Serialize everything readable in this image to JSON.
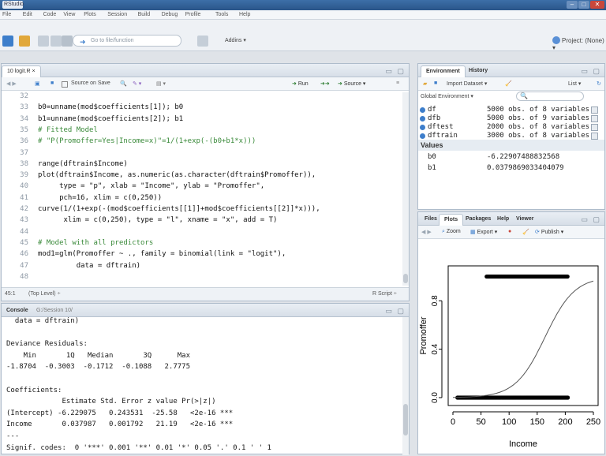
{
  "window": {
    "title": "RStudio",
    "min": "–",
    "max": "□",
    "close": "✕"
  },
  "menu": [
    "File",
    "Edit",
    "Code",
    "View",
    "Plots",
    "Session",
    "Build",
    "Debug",
    "Profile",
    "Tools",
    "Help"
  ],
  "toolbar": {
    "goto_placeholder": "Go to file/function",
    "addins": "Addins ▾",
    "project": "Project: (None) ▾"
  },
  "editor": {
    "tab": "10 logit.R ×",
    "source_on_save": "Source on Save",
    "run": "Run",
    "source": "Source ▾",
    "status_pos": "45:1",
    "status_level": "(Top Level) ÷",
    "status_lang": "R Script ÷",
    "lines": [
      {
        "n": "32",
        "t": ""
      },
      {
        "n": "33",
        "t": "b0=unname(mod$coefficients[1]); b0"
      },
      {
        "n": "34",
        "t": "b1=unname(mod$coefficients[2]); b1"
      },
      {
        "n": "35",
        "t": "# Fitted Model",
        "comment": true
      },
      {
        "n": "36",
        "t": "# \"P(Promoffer=Yes|Income=x)\"=1/(1+exp(-(b0+b1*x)))",
        "comment": true
      },
      {
        "n": "37",
        "t": ""
      },
      {
        "n": "38",
        "t": "range(dftrain$Income)"
      },
      {
        "n": "39",
        "t": "plot(dftrain$Income, as.numeric(as.character(dftrain$Promoffer)),"
      },
      {
        "n": "40",
        "t": "     type = \"p\", xlab = \"Income\", ylab = \"Promoffer\","
      },
      {
        "n": "41",
        "t": "     pch=16, xlim = c(0,250))"
      },
      {
        "n": "42",
        "t": "curve(1/(1+exp(-(mod$coefficients[[1]]+mod$coefficients[[2]]*x))),"
      },
      {
        "n": "43",
        "t": "      xlim = c(0,250), type = \"l\", xname = \"x\", add = T)"
      },
      {
        "n": "44",
        "t": ""
      },
      {
        "n": "45",
        "t": "# Model with all predictors",
        "comment": true
      },
      {
        "n": "46",
        "t": "mod1=glm(Promoffer ~ ., family = binomial(link = \"logit\"),"
      },
      {
        "n": "47",
        "t": "         data = dftrain)"
      },
      {
        "n": "48",
        "t": ""
      }
    ]
  },
  "console": {
    "tab": "Console",
    "path": "G:/Session 10/",
    "lines": [
      "  data = dftrain)",
      "",
      "Deviance Residuals:",
      "    Min       1Q   Median       3Q      Max",
      "-1.8704  -0.3003  -0.1712  -0.1088   2.7775",
      "",
      "Coefficients:",
      "             Estimate Std. Error z value Pr(>|z|)",
      "(Intercept) -6.229075   0.243531  -25.58   <2e-16 ***",
      "Income       0.037987   0.001792   21.19   <2e-16 ***",
      "---",
      "Signif. codes:  0 '***' 0.001 '**' 0.01 '*' 0.05 '.' 0.1 ' ' 1"
    ]
  },
  "environment": {
    "tabs": [
      "Environment",
      "History"
    ],
    "import": "Import Dataset ▾",
    "list": "List ▾",
    "scope": "Global Environment ▾",
    "data_rows": [
      {
        "name": "df",
        "value": "5000 obs. of 8 variables"
      },
      {
        "name": "dfb",
        "value": "5000 obs. of 9 variables"
      },
      {
        "name": "dftest",
        "value": "2000 obs. of 8 variables"
      },
      {
        "name": "dftrain",
        "value": "3000 obs. of 8 variables"
      }
    ],
    "values_header": "Values",
    "value_rows": [
      {
        "name": "b0",
        "value": "-6.22907488832568"
      },
      {
        "name": "b1",
        "value": "0.0379869033404079"
      }
    ]
  },
  "plots": {
    "tabs": [
      "Files",
      "Plots",
      "Packages",
      "Help",
      "Viewer"
    ],
    "zoom": "Zoom",
    "export": "Export ▾",
    "publish": "Publish ▾"
  },
  "chart_data": {
    "type": "scatter",
    "xlabel": "Income",
    "ylabel": "Promoffer",
    "xlim": [
      0,
      250
    ],
    "ylim": [
      0,
      1
    ],
    "xticks": [
      0,
      50,
      100,
      150,
      200,
      250
    ],
    "yticks": [
      0.0,
      0.4,
      0.8
    ],
    "ytick_labels": [
      "0.0",
      "0.4",
      "0.8"
    ],
    "points_y0_range": [
      8,
      205
    ],
    "points_y1_range": [
      60,
      205
    ],
    "curve": {
      "b0": -6.22907488832568,
      "b1": 0.0379869033404079
    },
    "color": "#000000"
  }
}
